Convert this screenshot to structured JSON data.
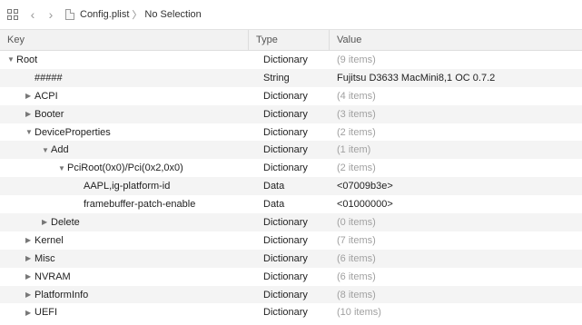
{
  "toolbar": {
    "grid_icon": "grid-icon",
    "back_icon": "chevron-left-icon",
    "forward_icon": "chevron-right-icon",
    "file_icon": "document-icon",
    "breadcrumb_file": "Config.plist",
    "breadcrumb_sep": "〉",
    "breadcrumb_selection": "No Selection"
  },
  "table": {
    "headers": {
      "key": "Key",
      "type": "Type",
      "value": "Value"
    },
    "rows": [
      {
        "triangle": "▼",
        "key": "Root",
        "type": "Dictionary",
        "value": "(9 items)"
      },
      {
        "triangle": "",
        "key": "#####",
        "type": "String",
        "value": "Fujitsu D3633 MacMini8,1 OC 0.7.2"
      },
      {
        "triangle": "▶",
        "key": "ACPI",
        "type": "Dictionary",
        "value": "(4 items)"
      },
      {
        "triangle": "▶",
        "key": "Booter",
        "type": "Dictionary",
        "value": "(3 items)"
      },
      {
        "triangle": "▼",
        "key": "DeviceProperties",
        "type": "Dictionary",
        "value": "(2 items)"
      },
      {
        "triangle": "▼",
        "key": "Add",
        "type": "Dictionary",
        "value": "(1 item)"
      },
      {
        "triangle": "▼",
        "key": "PciRoot(0x0)/Pci(0x2,0x0)",
        "type": "Dictionary",
        "value": "(2 items)"
      },
      {
        "triangle": "",
        "key": "AAPL,ig-platform-id",
        "type": "Data",
        "value": "<07009b3e>"
      },
      {
        "triangle": "",
        "key": "framebuffer-patch-enable",
        "type": "Data",
        "value": "<01000000>"
      },
      {
        "triangle": "▶",
        "key": "Delete",
        "type": "Dictionary",
        "value": "(0 items)"
      },
      {
        "triangle": "▶",
        "key": "Kernel",
        "type": "Dictionary",
        "value": "(7 items)"
      },
      {
        "triangle": "▶",
        "key": "Misc",
        "type": "Dictionary",
        "value": "(6 items)"
      },
      {
        "triangle": "▶",
        "key": "NVRAM",
        "type": "Dictionary",
        "value": "(6 items)"
      },
      {
        "triangle": "▶",
        "key": "PlatformInfo",
        "type": "Dictionary",
        "value": "(8 items)"
      },
      {
        "triangle": "▶",
        "key": "UEFI",
        "type": "Dictionary",
        "value": "(10 items)"
      }
    ]
  }
}
